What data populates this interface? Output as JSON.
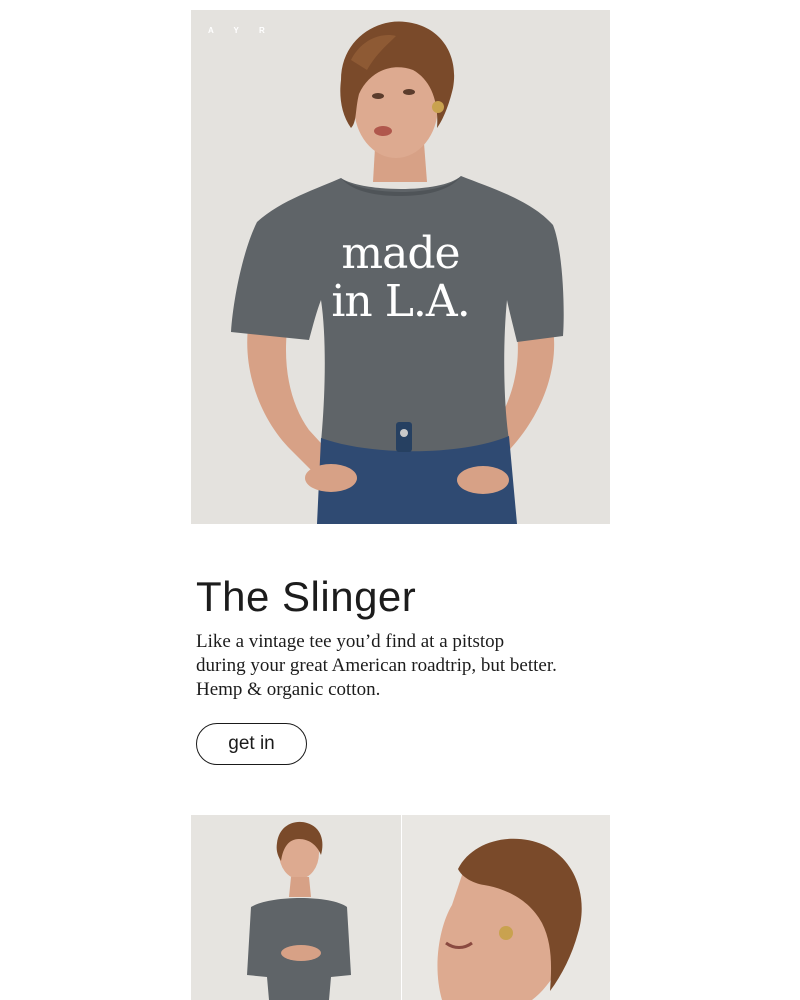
{
  "hero": {
    "brand_mark": "A Y R",
    "shirt_print_line1": "made",
    "shirt_print_line2": "in L.A.",
    "image_alt": "Model wearing a grey made in L.A. tee and blue jeans"
  },
  "product": {
    "title": "The Slinger",
    "description_lines": [
      "Like a vintage tee you’d find at a pitstop",
      "during your great American roadtrip, but better.",
      "Hemp & organic cotton."
    ],
    "cta_label": "get in"
  },
  "gallery": {
    "images": [
      {
        "alt": "Model in grey tee, standing"
      },
      {
        "alt": "Model smiling, close-up profile"
      }
    ]
  },
  "colors": {
    "background": "#ffffff",
    "text": "#1c1c1c",
    "photo_backdrop": "#e4e2de",
    "tee_grey": "#5f6468",
    "denim": "#2f4a72",
    "hair": "#7a4a2a",
    "skin": "#d9a48a"
  }
}
